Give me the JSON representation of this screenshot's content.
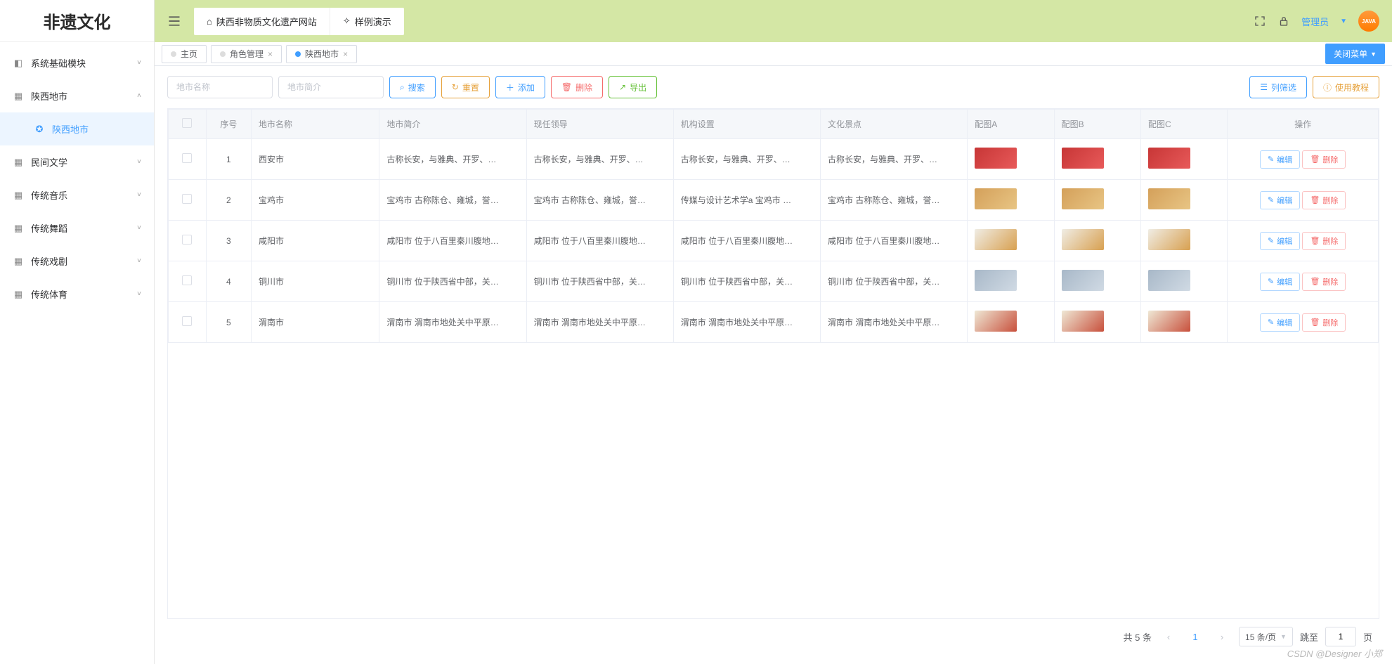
{
  "logo_text": "非遗文化",
  "header": {
    "site_name": "陕西非物质文化遗产网站",
    "demo_label": "样例演示",
    "admin_label": "管理员"
  },
  "sidebar": {
    "items": [
      {
        "label": "系统基础模块",
        "expanded": false,
        "type": "sys"
      },
      {
        "label": "陕西地市",
        "expanded": true,
        "type": "grid",
        "active": false
      },
      {
        "label": "陕西地市",
        "sub": true,
        "active": true,
        "type": "globe"
      },
      {
        "label": "民间文学",
        "expanded": false,
        "type": "grid"
      },
      {
        "label": "传统音乐",
        "expanded": false,
        "type": "grid"
      },
      {
        "label": "传统舞蹈",
        "expanded": false,
        "type": "grid"
      },
      {
        "label": "传统戏剧",
        "expanded": false,
        "type": "grid"
      },
      {
        "label": "传统体育",
        "expanded": false,
        "type": "grid"
      }
    ]
  },
  "tabs": {
    "items": [
      {
        "label": "主页",
        "active": false,
        "closable": false
      },
      {
        "label": "角色管理",
        "active": false,
        "closable": true
      },
      {
        "label": "陕西地市",
        "active": true,
        "closable": true
      }
    ],
    "close_menu_label": "关闭菜单"
  },
  "toolbar": {
    "input_name_ph": "地市名称",
    "input_intro_ph": "地市简介",
    "search": "搜索",
    "reset": "重置",
    "add": "添加",
    "delete": "删除",
    "export": "导出",
    "filter": "列筛选",
    "tutorial": "使用教程"
  },
  "table": {
    "headers": [
      "序号",
      "地市名称",
      "地市简介",
      "现任领导",
      "机构设置",
      "文化景点",
      "配图A",
      "配图B",
      "配图C",
      "操作"
    ],
    "op_edit": "编辑",
    "op_delete": "删除",
    "rows": [
      {
        "idx": 1,
        "name": "西安市",
        "intro": "古称长安，与雅典、开罗、…",
        "leader": "古称长安，与雅典、开罗、…",
        "org": "古称长安，与雅典、开罗、…",
        "scenic": "古称长安，与雅典、开罗、…",
        "imgv": "v1"
      },
      {
        "idx": 2,
        "name": "宝鸡市",
        "intro": "宝鸡市 古称陈仓、雍城，誉…",
        "leader": "宝鸡市 古称陈仓、雍城，誉…",
        "org": "传媒与设计艺术学a 宝鸡市 …",
        "scenic": "宝鸡市 古称陈仓、雍城，誉…",
        "imgv": "v2"
      },
      {
        "idx": 3,
        "name": "咸阳市",
        "intro": "咸阳市 位于八百里秦川腹地…",
        "leader": "咸阳市 位于八百里秦川腹地…",
        "org": "咸阳市 位于八百里秦川腹地…",
        "scenic": "咸阳市 位于八百里秦川腹地…",
        "imgv": "v3"
      },
      {
        "idx": 4,
        "name": "铜川市",
        "intro": "铜川市 位于陕西省中部，关…",
        "leader": "铜川市 位于陕西省中部，关…",
        "org": "铜川市 位于陕西省中部，关…",
        "scenic": "铜川市 位于陕西省中部，关…",
        "imgv": "v4"
      },
      {
        "idx": 5,
        "name": "渭南市",
        "intro": "渭南市 渭南市地处关中平原…",
        "leader": "渭南市 渭南市地处关中平原…",
        "org": "渭南市 渭南市地处关中平原…",
        "scenic": "渭南市 渭南市地处关中平原…",
        "imgv": "v5"
      }
    ]
  },
  "pagination": {
    "total_text": "共 5 条",
    "page": "1",
    "per_page": "15 条/页",
    "jump_label": "跳至",
    "jump_val": "1",
    "page_label": "页"
  },
  "watermark": "CSDN @Designer 小郑"
}
